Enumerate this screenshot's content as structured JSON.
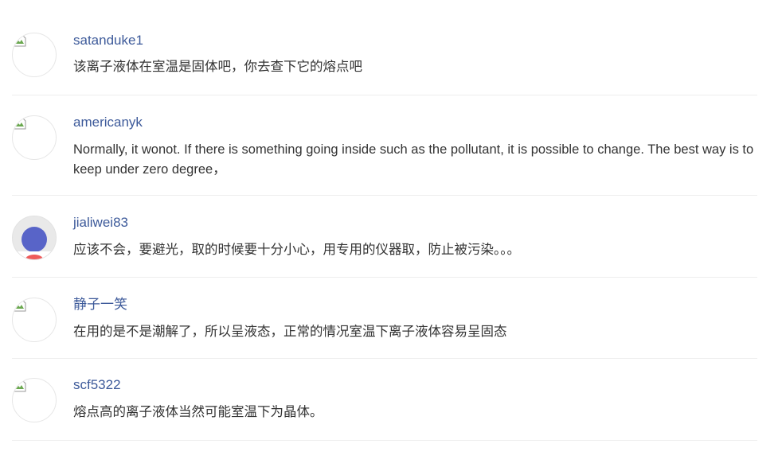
{
  "comments": [
    {
      "username": "satanduke1",
      "text": "该离子液体在室温是固体吧，你去查下它的熔点吧",
      "avatar": "broken-image-icon"
    },
    {
      "username": "americanyk",
      "text": "Normally, it wonot. If there is something going inside such as the pollutant,  it is possible to change. The best way is to keep under zero degree，",
      "avatar": "broken-image-icon"
    },
    {
      "username": "jialiwei83",
      "text": "应该不会，要避光，取的时候要十分小心，用专用的仪器取，防止被污染。。。",
      "avatar": "user-avatar-icon"
    },
    {
      "username": "静子一笑",
      "text": "在用的是不是潮解了，所以呈液态，正常的情况室温下离子液体容易呈固态",
      "avatar": "broken-image-icon"
    },
    {
      "username": "scf5322",
      "text": "熔点高的离子液体当然可能室温下为晶体。",
      "avatar": "broken-image-icon"
    }
  ]
}
